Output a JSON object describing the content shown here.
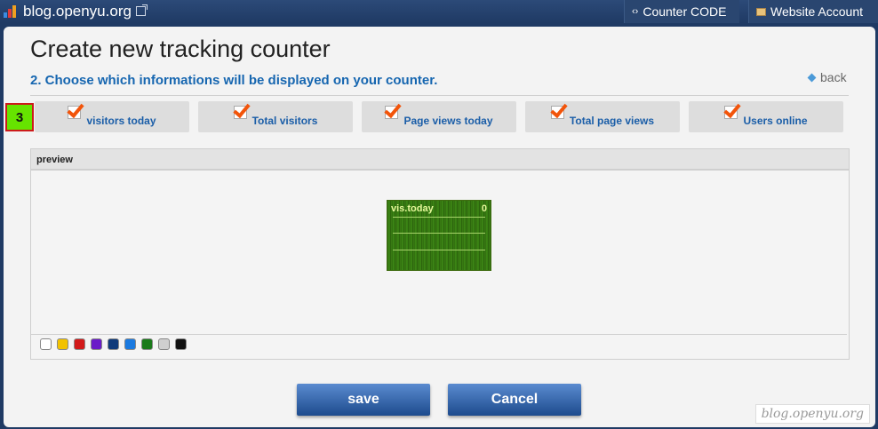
{
  "topbar": {
    "site": "blog.openyu.org",
    "counter_code": "Counter CODE",
    "website_account": "Website Account",
    "counter_code_icon": "code-icon",
    "website_account_icon": "folder-icon"
  },
  "main": {
    "title": "Create new tracking counter",
    "step": "2. Choose which informations will be displayed on your counter.",
    "back": "back"
  },
  "badge": "3",
  "options": [
    {
      "label": "visitors today",
      "checked": true
    },
    {
      "label": "Total visitors",
      "checked": true
    },
    {
      "label": "Page views today",
      "checked": true
    },
    {
      "label": "Total page views",
      "checked": true
    },
    {
      "label": "Users online",
      "checked": true
    }
  ],
  "preview": {
    "label": "preview",
    "widget": {
      "title": "vis.today",
      "value": "0"
    },
    "swatches": [
      "#ffffff",
      "#f2c200",
      "#d21a1a",
      "#6a1cc8",
      "#0f3a7a",
      "#1b7ae0",
      "#1a7a1a",
      "#cfcfcf",
      "#111111"
    ]
  },
  "buttons": {
    "save": "save",
    "cancel": "Cancel"
  },
  "watermark": "blog.openyu.org",
  "colors": {
    "accent": "#1666b0",
    "topbar": "#1f3a64",
    "badge_bg": "#66e400",
    "badge_border": "#cc1a1a"
  }
}
